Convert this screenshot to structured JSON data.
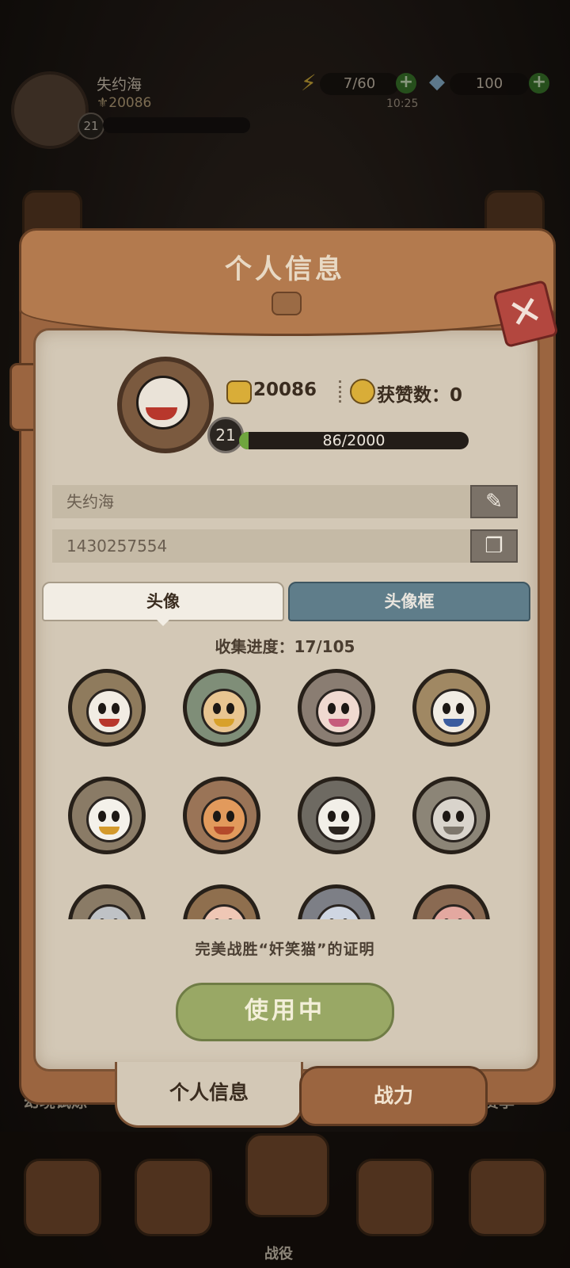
{
  "hud": {
    "player_name": "失约海",
    "coins": "20086",
    "level": "21",
    "energy": "7/60",
    "gems": "100",
    "timer": "10:25"
  },
  "panel": {
    "title": "个人信息",
    "close_icon": "close-x-icon",
    "profile": {
      "coins": "20086",
      "likes_label": "获赞数：0",
      "level": "21",
      "xp_text": "86/2000",
      "xp_fraction": 0.043
    },
    "name_field": "失约海",
    "id_field": "1430257554",
    "edit_icon": "✎",
    "copy_icon": "❐",
    "tabs": {
      "avatar": "头像",
      "frame": "头像框"
    },
    "collection_progress": "收集进度：17/105",
    "avatars": [
      {
        "bg": "#8f7b5d",
        "face": "#f1ece3",
        "accent": "#b8372c"
      },
      {
        "bg": "#7f8e78",
        "face": "#e8c591",
        "accent": "#d8a12a"
      },
      {
        "bg": "#8a7d72",
        "face": "#f0d9d0",
        "accent": "#c65b7c"
      },
      {
        "bg": "#a08863",
        "face": "#f1ece3",
        "accent": "#3b5c9e"
      },
      {
        "bg": "#8a7b66",
        "face": "#f4f1ea",
        "accent": "#d49a2c"
      },
      {
        "bg": "#9a7457",
        "face": "#e29a5c",
        "accent": "#b44a2b"
      },
      {
        "bg": "#6e6a62",
        "face": "#f2efe8",
        "accent": "#2b2520"
      },
      {
        "bg": "#8c8577",
        "face": "#d9d4cc",
        "accent": "#7e776d"
      },
      {
        "bg": "#8a7b66",
        "face": "#bfc2c6",
        "accent": "#b8372c"
      },
      {
        "bg": "#8f6f4e",
        "face": "#efc7b5",
        "accent": "#e2c03a"
      },
      {
        "bg": "#7d7f86",
        "face": "#cfd6e2",
        "accent": "#e2c03a"
      },
      {
        "bg": "#8a6a52",
        "face": "#e3a8a0",
        "accent": "#7b3c2c"
      }
    ],
    "description": "完美战胜“奸笑猫”的证明",
    "use_button": "使用中",
    "bottom_tabs": {
      "info": "个人信息",
      "power": "战力"
    }
  },
  "background_labels": {
    "left": "幻境试炼",
    "right": "赛季"
  },
  "nav": {
    "center_label": "战役",
    "icons": [
      "chest-star-icon",
      "treasure-box-icon",
      "battle-icon",
      "pilot-helmet-icon",
      "star-crate-icon"
    ]
  }
}
